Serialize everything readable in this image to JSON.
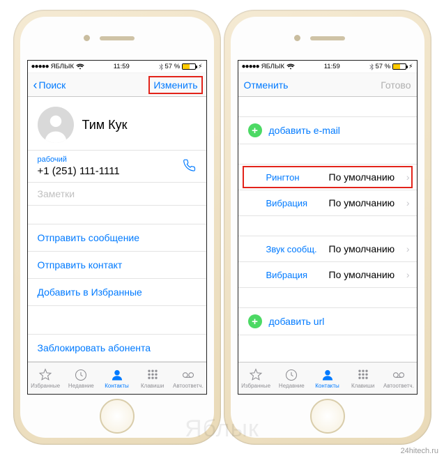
{
  "status": {
    "carrier": "ЯБЛЫК",
    "time": "11:59",
    "battery_pct": "57 %"
  },
  "left": {
    "nav_back": "Поиск",
    "nav_action": "Изменить",
    "contact_name": "Тим Кук",
    "phone_label": "рабочий",
    "phone_value": "+1 (251) 111-1111",
    "notes_placeholder": "Заметки",
    "actions": {
      "send_message": "Отправить сообщение",
      "send_contact": "Отправить контакт",
      "add_favorite": "Добавить в Избранные",
      "block": "Заблокировать абонента"
    }
  },
  "right": {
    "nav_cancel": "Отменить",
    "nav_done": "Готово",
    "add_email": "добавить e-mail",
    "add_url": "добавить url",
    "rows": {
      "ringtone_label": "Рингтон",
      "ringtone_value": "По умолчанию",
      "vibration_label": "Вибрация",
      "vibration_value": "По умолчанию",
      "text_tone_label": "Звук сообщ.",
      "text_tone_value": "По умолчанию",
      "vibration2_label": "Вибрация",
      "vibration2_value": "По умолчанию"
    }
  },
  "tabs": {
    "favorites": "Избранные",
    "recents": "Недавние",
    "contacts": "Контакты",
    "keypad": "Клавиши",
    "voicemail": "Автоответч."
  },
  "watermark": "Яблык",
  "credit": "24hitech.ru"
}
